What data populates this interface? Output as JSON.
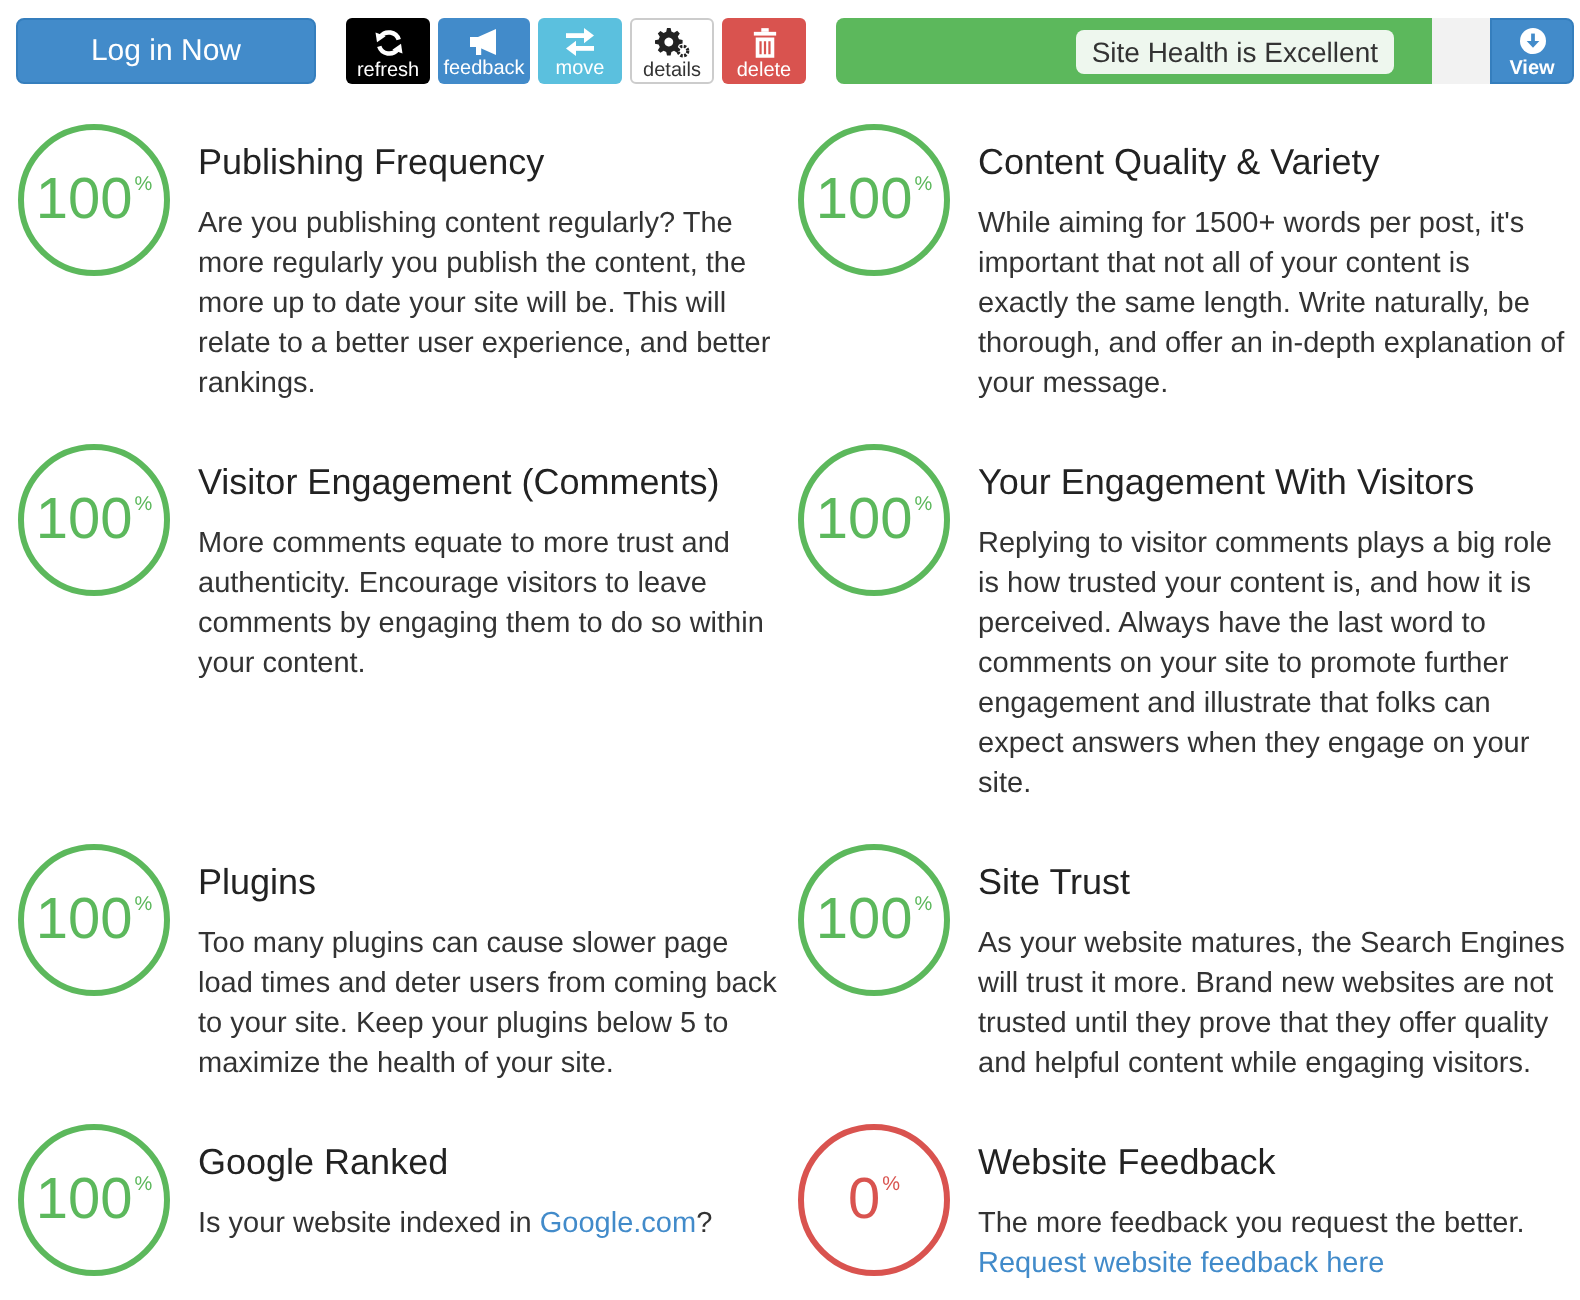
{
  "login_button": {
    "label": "Log in Now"
  },
  "toolbar": [
    {
      "kind": "refresh",
      "label": "refresh"
    },
    {
      "kind": "feedback",
      "label": "feedback"
    },
    {
      "kind": "move",
      "label": "move"
    },
    {
      "kind": "details",
      "label": "details"
    },
    {
      "kind": "delete",
      "label": "delete"
    }
  ],
  "health": {
    "label": "Site Health is Excellent",
    "level": 0.91
  },
  "view_button": {
    "label": "View"
  },
  "metrics": [
    {
      "title": "Publishing Frequency",
      "score": "100",
      "unit": "%",
      "color": "#5cb85c",
      "description": [
        {
          "kind": "text",
          "text": "Are you publishing content regularly? The more regularly you publish the content, the more up to date your site will be. This will relate to a better user experience, and better rankings."
        }
      ]
    },
    {
      "title": "Content Quality & Variety",
      "score": "100",
      "unit": "%",
      "color": "#5cb85c",
      "description": [
        {
          "kind": "text",
          "text": "While aiming for 1500+ words per post, it's important that not all of your content is exactly the same length. Write naturally, be thorough, and offer an in-depth explanation of your message."
        }
      ]
    },
    {
      "title": "Visitor Engagement (Comments)",
      "score": "100",
      "unit": "%",
      "color": "#5cb85c",
      "description": [
        {
          "kind": "text",
          "text": "More comments equate to more trust and authenticity. Encourage visitors to leave comments by engaging them to do so within your content."
        }
      ]
    },
    {
      "title": "Your Engagement With Visitors",
      "score": "100",
      "unit": "%",
      "color": "#5cb85c",
      "description": [
        {
          "kind": "text",
          "text": "Replying to visitor comments plays a big role is how trusted your content is, and how it is perceived. Always have the last word to comments on your site to promote further engagement and illustrate that folks can expect answers when they engage on your site."
        }
      ]
    },
    {
      "title": "Plugins",
      "score": "100",
      "unit": "%",
      "color": "#5cb85c",
      "description": [
        {
          "kind": "text",
          "text": "Too many plugins can cause slower page load times and deter users from coming back to your site. Keep your plugins below 5 to maximize the health of your site."
        }
      ]
    },
    {
      "title": "Site Trust",
      "score": "100",
      "unit": "%",
      "color": "#5cb85c",
      "description": [
        {
          "kind": "text",
          "text": "As your website matures, the Search Engines will trust it more. Brand new websites are not trusted until they prove that they offer quality and helpful content while engaging visitors."
        }
      ]
    },
    {
      "title": "Google Ranked",
      "score": "100",
      "unit": "%",
      "color": "#5cb85c",
      "description": [
        {
          "kind": "text",
          "text": "Is your website indexed in "
        },
        {
          "kind": "link",
          "text": "Google.com"
        },
        {
          "kind": "text",
          "text": "?"
        }
      ]
    },
    {
      "title": "Website Feedback",
      "score": "0",
      "unit": "%",
      "color": "#d9534f",
      "description": [
        {
          "kind": "text",
          "text": "The more feedback you request the better. "
        },
        {
          "kind": "link",
          "text": "Request website feedback here"
        }
      ]
    }
  ]
}
